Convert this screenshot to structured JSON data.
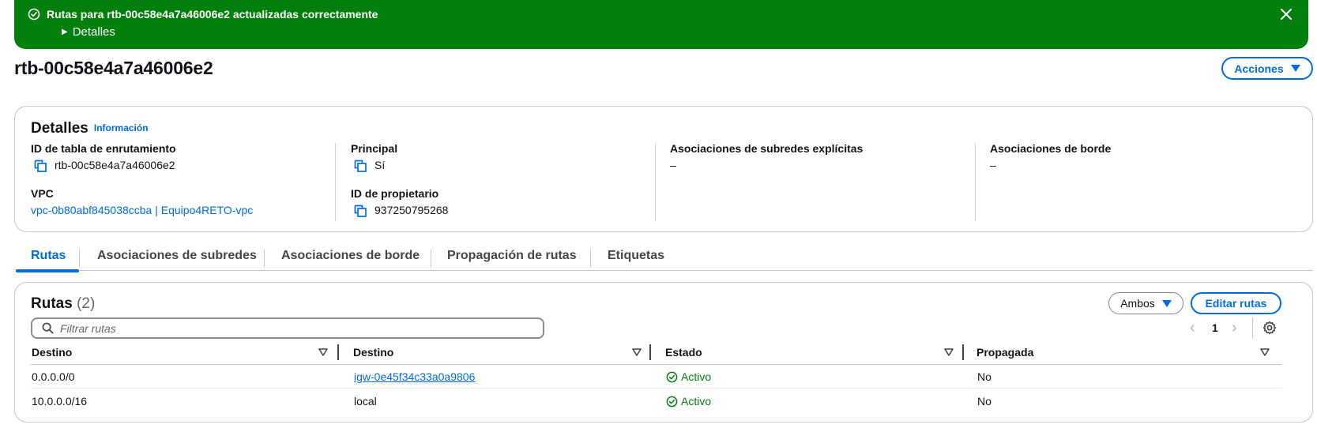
{
  "flash": {
    "message": "Rutas para rtb-00c58e4a7a46006e2 actualizadas correctamente",
    "details": "Detalles",
    "color": "#037f0c"
  },
  "header": {
    "title": "rtb-00c58e4a7a46006e2",
    "actions": "Acciones"
  },
  "details": {
    "title": "Detalles",
    "info": "Información",
    "fields": {
      "route_table_id_label": "ID de tabla de enrutamiento",
      "route_table_id_value": "rtb-00c58e4a7a46006e2",
      "vpc_label": "VPC",
      "vpc_value": "vpc-0b80abf845038ccba | Equipo4RETO-vpc",
      "main_label": "Principal",
      "main_value": "Sí",
      "owner_label": "ID de propietario",
      "owner_value": "937250795268",
      "subnet_assoc_label": "Asociaciones de subredes explícitas",
      "subnet_assoc_value": "–",
      "edge_assoc_label": "Asociaciones de borde",
      "edge_assoc_value": "–"
    }
  },
  "tabs": [
    {
      "label": "Rutas",
      "active": true
    },
    {
      "label": "Asociaciones de subredes",
      "active": false
    },
    {
      "label": "Asociaciones de borde",
      "active": false
    },
    {
      "label": "Propagación de rutas",
      "active": false
    },
    {
      "label": "Etiquetas",
      "active": false
    }
  ],
  "routes": {
    "title": "Rutas",
    "count": "(2)",
    "filter_button": "Ambos",
    "edit_button": "Editar rutas",
    "search_placeholder": "Filtrar rutas",
    "page": "1",
    "columns": [
      "Destino",
      "Destino",
      "Estado",
      "Propagada"
    ],
    "rows": [
      {
        "destination": "0.0.0.0/0",
        "target": "igw-0e45f34c33a0a9806",
        "status": "Activo",
        "propagated": "No"
      },
      {
        "destination": "10.0.0.0/16",
        "target": "local",
        "status": "Activo",
        "propagated": "No"
      }
    ]
  },
  "colors": {
    "accent": "#006ce0",
    "success": "#037f0c",
    "text": "#0f141a"
  },
  "icons": [
    "check-circle-icon",
    "caret-right-icon",
    "close-icon",
    "chevron-down-icon",
    "copy-icon",
    "search-icon",
    "chevron-left-icon",
    "chevron-right-icon",
    "settings-icon",
    "sort-icon"
  ]
}
